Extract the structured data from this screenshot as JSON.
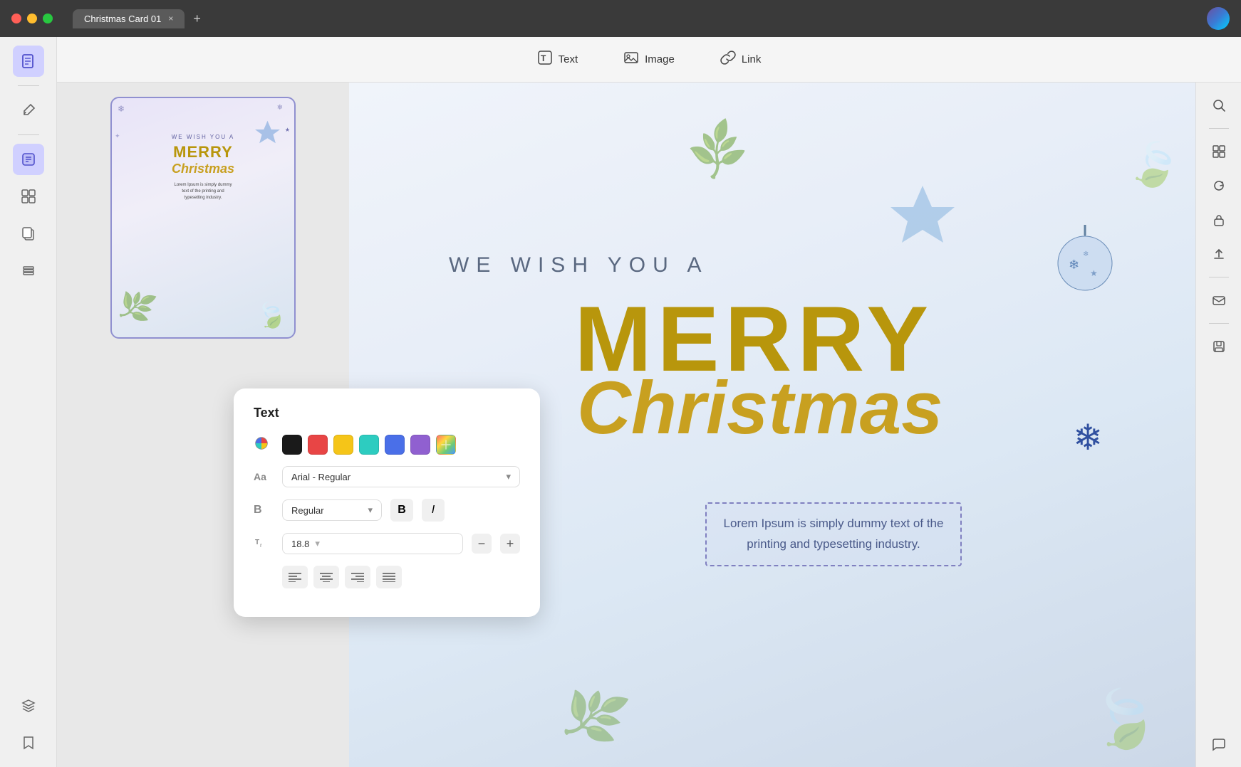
{
  "titlebar": {
    "tab_title": "Christmas Card 01",
    "tab_close": "×",
    "tab_add": "+"
  },
  "toolbar": {
    "text_label": "Text",
    "image_label": "Image",
    "link_label": "Link"
  },
  "text_panel": {
    "title": "Text",
    "font_name": "Arial - Regular",
    "font_weight": "Regular",
    "font_size": "18.8",
    "colors": {
      "black": "#1a1a1a",
      "red": "#e84545",
      "yellow": "#f5c518",
      "teal": "#2dccc0",
      "blue": "#4a6fe8",
      "purple": "#9060d0"
    },
    "bold_label": "B",
    "italic_label": "I",
    "align_left": "≡",
    "align_center": "≡",
    "align_right": "≡",
    "align_justify": "≡",
    "size_decrease": "−",
    "size_increase": "+"
  },
  "card": {
    "we_wish": "WE WISH YOU A",
    "merry": "MERRY",
    "christmas": "Christmas",
    "lorem": "Lorem Ipsum is simply dummy text of the printing and typesetting industry.",
    "lorem_mini": "Lorem Ipsum is simply dummy\ntext of the printing and\ntypesetting industry."
  },
  "sidebar_left": {
    "icons": [
      "📋",
      "✏️",
      "📝",
      "📄",
      "🖼️",
      "📦"
    ]
  },
  "sidebar_right": {
    "icons": [
      "🔍",
      "□",
      "🔄",
      "🔒",
      "⬆️",
      "✉️",
      "💾",
      "💬"
    ]
  }
}
